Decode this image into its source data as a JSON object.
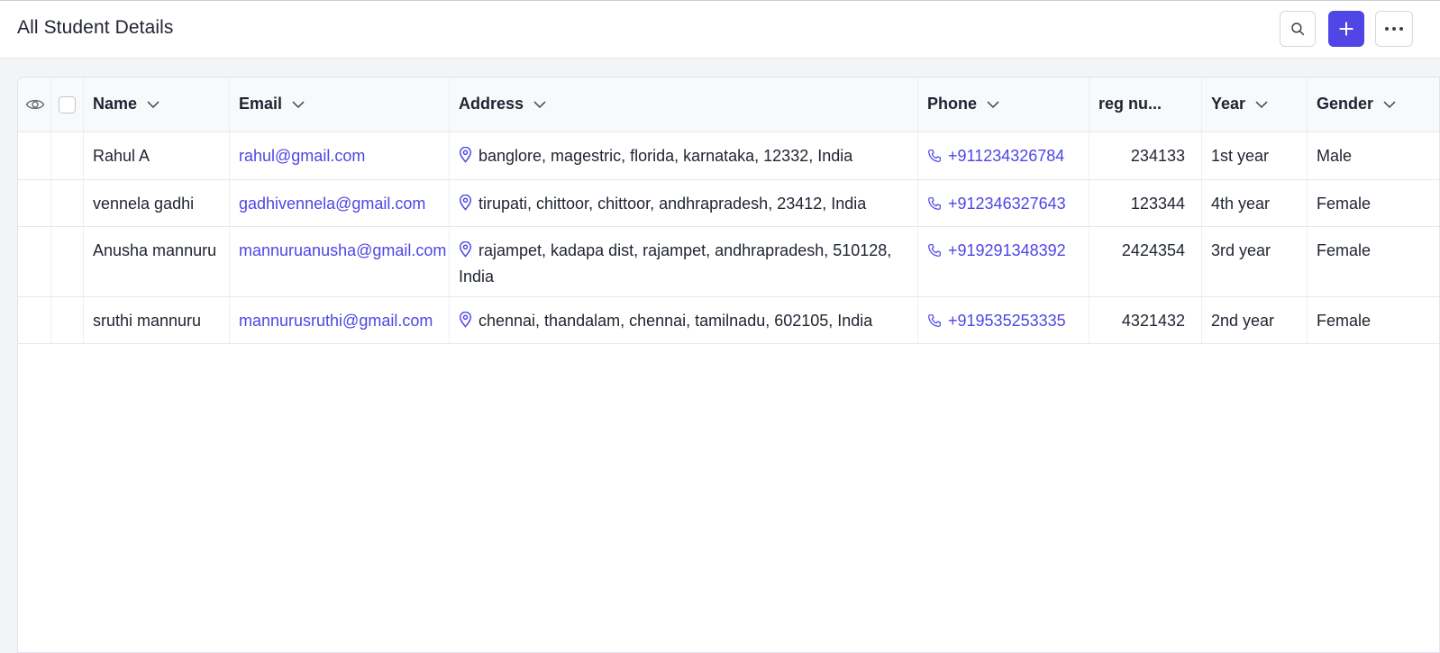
{
  "header": {
    "title": "All Student Details",
    "icons": {
      "search": "search-icon",
      "add": "plus-icon",
      "more": "more-horizontal-icon"
    }
  },
  "table": {
    "columns": [
      {
        "key": "name",
        "label": "Name"
      },
      {
        "key": "email",
        "label": "Email"
      },
      {
        "key": "address",
        "label": "Address"
      },
      {
        "key": "phone",
        "label": "Phone"
      },
      {
        "key": "reg",
        "label": "reg nu..."
      },
      {
        "key": "year",
        "label": "Year"
      },
      {
        "key": "gender",
        "label": "Gender"
      }
    ],
    "rows": [
      {
        "name": "Rahul A",
        "email": "rahul@gmail.com",
        "address": "banglore, magestric, florida, karnataka, 12332, India",
        "phone": "+911234326784",
        "reg": "234133",
        "year": "1st year",
        "gender": "Male"
      },
      {
        "name": "vennela gadhi",
        "email": "gadhivennela@gmail.com",
        "address": "tirupati, chittoor, chittoor, andhrapradesh, 23412, India",
        "phone": "+912346327643",
        "reg": "123344",
        "year": "4th year",
        "gender": "Female"
      },
      {
        "name": "Anusha mannuru",
        "email": "mannuruanusha@gmail.com",
        "address": "rajampet, kadapa dist, rajampet, andhrapradesh, 510128, India",
        "phone": "+919291348392",
        "reg": "2424354",
        "year": "3rd year",
        "gender": "Female"
      },
      {
        "name": "sruthi mannuru",
        "email": "mannurusruthi@gmail.com",
        "address": "chennai, thandalam, chennai, tamilnadu, 602105, India",
        "phone": "+919535253335",
        "reg": "4321432",
        "year": "2nd year",
        "gender": "Female"
      }
    ]
  },
  "colors": {
    "accent": "#4f46e5",
    "text": "#1f2430",
    "background": "#f3f4f6"
  }
}
